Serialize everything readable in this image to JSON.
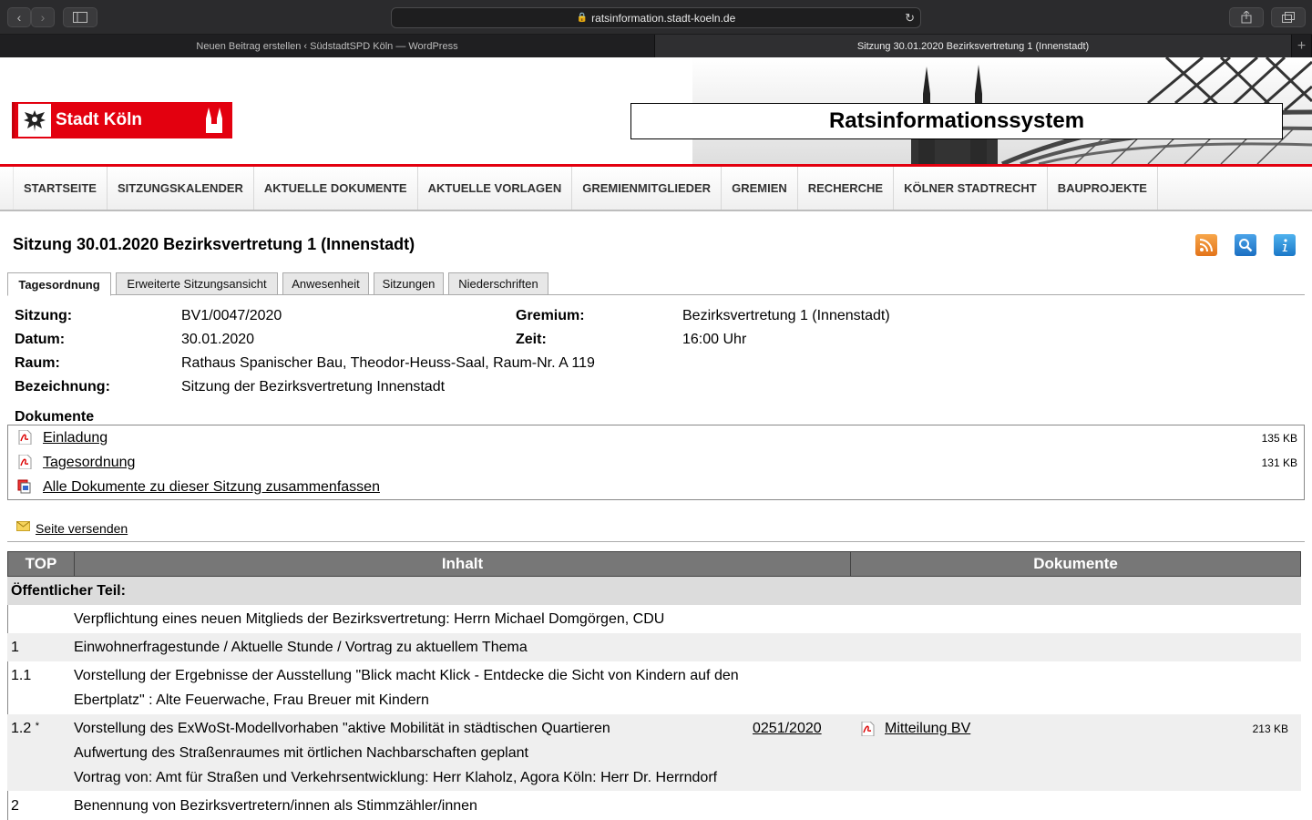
{
  "browser": {
    "url": "ratsinformation.stadt-koeln.de",
    "tabs": [
      {
        "label": "Neuen Beitrag erstellen ‹ SüdstadtSPD Köln — WordPress",
        "active": false
      },
      {
        "label": "Sitzung 30.01.2020 Bezirksvertretung 1 (Innenstadt)",
        "active": true
      }
    ]
  },
  "header": {
    "logo_text": "Stadt Köln",
    "system_title": "Ratsinformationssystem"
  },
  "nav": {
    "items": [
      "STARTSEITE",
      "SITZUNGSKALENDER",
      "AKTUELLE DOKUMENTE",
      "AKTUELLE VORLAGEN",
      "GREMIENMITGLIEDER",
      "GREMIEN",
      "RECHERCHE",
      "KÖLNER STADTRECHT",
      "BAUPROJEKTE"
    ]
  },
  "page": {
    "title": "Sitzung 30.01.2020 Bezirksvertretung 1 (Innenstadt)",
    "subtabs": [
      "Tagesordnung",
      "Erweiterte Sitzungsansicht",
      "Anwesenheit",
      "Sitzungen",
      "Niederschriften"
    ]
  },
  "info": {
    "sitzung_label": "Sitzung:",
    "sitzung": "BV1/0047/2020",
    "gremium_label": "Gremium:",
    "gremium": "Bezirksvertretung 1 (Innenstadt)",
    "datum_label": "Datum:",
    "datum": "30.01.2020",
    "zeit_label": "Zeit:",
    "zeit": "16:00 Uhr",
    "raum_label": "Raum:",
    "raum": "Rathaus Spanischer Bau, Theodor-Heuss-Saal, Raum-Nr. A 119",
    "bezeichnung_label": "Bezeichnung:",
    "bezeichnung": "Sitzung der Bezirksvertretung Innenstadt"
  },
  "documents": {
    "heading": "Dokumente",
    "items": [
      {
        "label": "Einladung",
        "size": "135 KB"
      },
      {
        "label": "Tagesordnung",
        "size": "131 KB"
      },
      {
        "label": "Alle Dokumente zu dieser Sitzung zusammenfassen",
        "size": ""
      }
    ]
  },
  "send_page": "Seite versenden",
  "agenda": {
    "headers": [
      "TOP",
      "Inhalt",
      "Dokumente"
    ],
    "section": "Öffentlicher Teil:",
    "rows": [
      {
        "num": "",
        "lines": [
          "Verpflichtung eines neuen Mitglieds der Bezirksvertretung: Herrn Michael Domgörgen, CDU"
        ]
      },
      {
        "num": "1",
        "lines": [
          "Einwohnerfragestunde / Aktuelle Stunde / Vortrag zu aktuellem Thema"
        ]
      },
      {
        "num": "1.1",
        "lines": [
          "Vorstellung der Ergebnisse der Ausstellung \"Blick macht Klick - Entdecke die Sicht von Kindern auf den",
          "Ebertplatz\" : Alte Feuerwache, Frau Breuer mit Kindern"
        ]
      },
      {
        "num": "1.2",
        "star": "*",
        "lines": [
          "Vorstellung des ExWoSt-Modellvorhaben \"aktive Mobilität in städtischen Quartieren",
          "Aufwertung des Straßenraumes mit örtlichen Nachbarschaften geplant",
          "Vortrag von: Amt für Straßen und Verkehrsentwicklung: Herr Klaholz, Agora Köln: Herr Dr. Herrndorf"
        ],
        "vorlage": "0251/2020",
        "doc": "Mitteilung BV",
        "doc_size": "213 KB"
      },
      {
        "num": "2",
        "lines": [
          "Benennung von Bezirksvertretern/innen als Stimmzähler/innen"
        ]
      }
    ]
  }
}
